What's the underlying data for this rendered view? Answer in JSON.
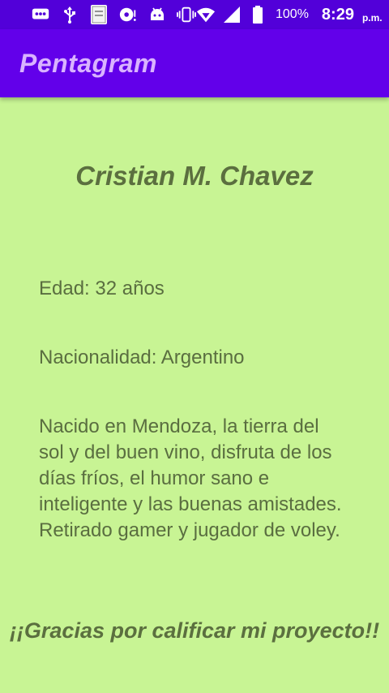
{
  "status_bar": {
    "icons": [
      "message-icon",
      "usb-icon",
      "bible-app-icon",
      "disc-sync-icon",
      "android-debug-icon",
      "vibrate-icon",
      "wifi-icon",
      "signal-icon",
      "battery-icon"
    ],
    "battery": "100%",
    "time": "8:29",
    "ampm": "p.m."
  },
  "app_bar": {
    "title": "Pentagram"
  },
  "profile": {
    "name": "Cristian M. Chavez",
    "age": "Edad: 32 años",
    "nationality": "Nacionalidad: Argentino",
    "bio": "Nacido en Mendoza, la tierra del sol y del buen vino, disfruta de los días fríos, el humor sano e inteligente y las buenas amistades. Retirado gamer y jugador de voley.",
    "thanks": "¡¡Gracias por calificar mi proyecto!!"
  },
  "colors": {
    "status_bar": "#5200d9",
    "app_bar": "#6200ea",
    "title": "#d9b3ff",
    "background": "#c8f494",
    "text": "#5a6e40"
  }
}
